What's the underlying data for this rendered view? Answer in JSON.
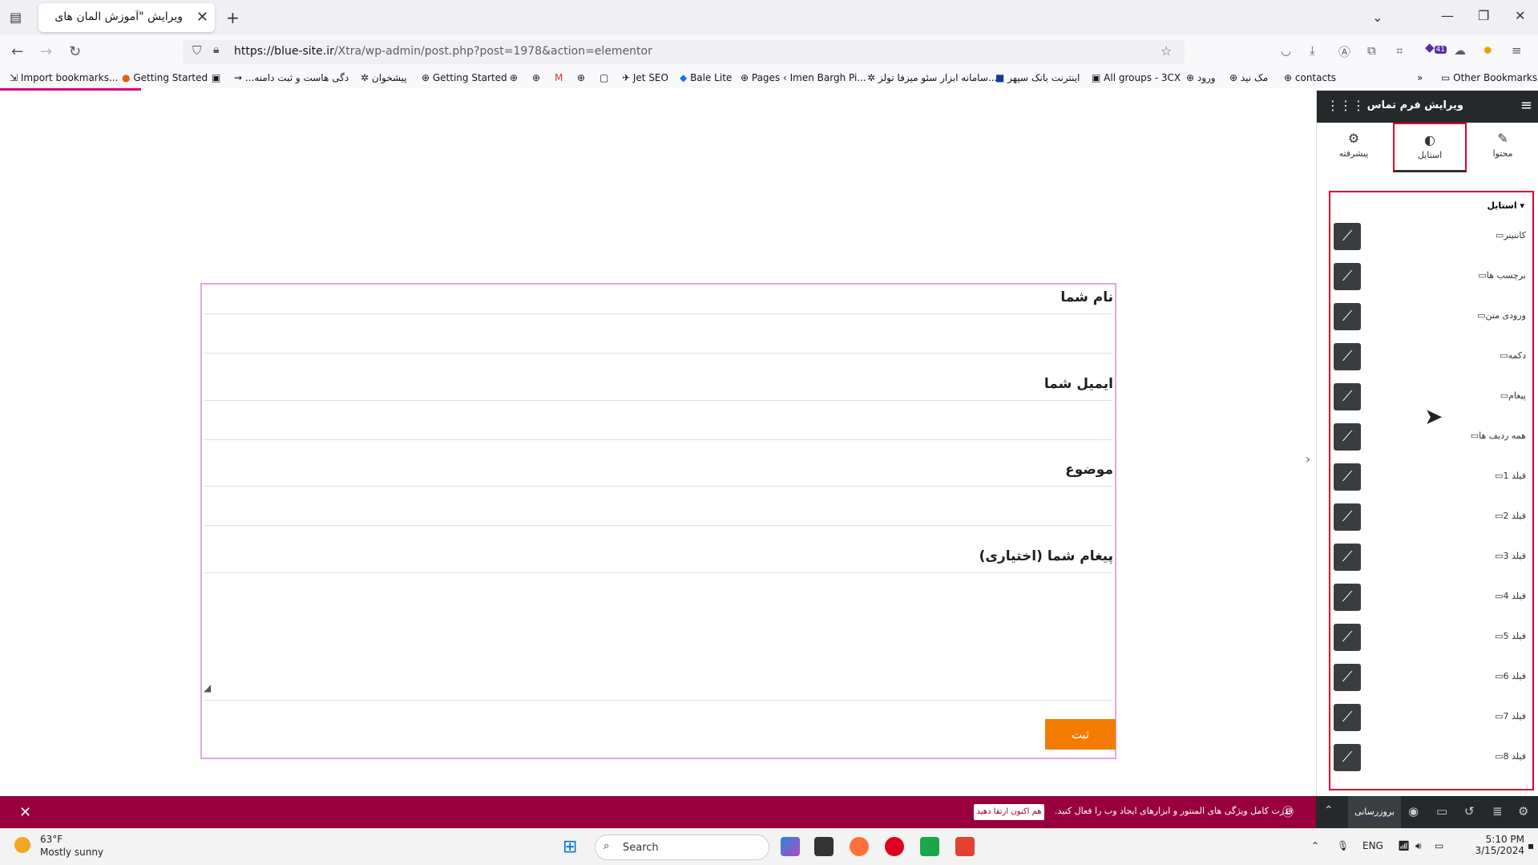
{
  "browser": {
    "tab_title": "ویرایش \"آموزش المان های اکسترا – ...",
    "url_host": "https://blue-site.ir",
    "url_path": "/Xtra/wp-admin/post.php?post=1978&action=elementor",
    "extension_badge": "41"
  },
  "bookmarks": {
    "items": [
      "Import bookmarks...",
      "Getting Started",
      "...دگی هاست و ثبت دامنه",
      "پیشخوان",
      "Getting Started",
      "Jet SEO",
      "Bale Lite",
      "Pages ‹ Imen Bargh Pi...",
      "سامانه ابزار سئو میزفا تولز...",
      "اینترنت بانک سپهر",
      "All groups - 3CX",
      "ورود",
      "مک نید",
      "contacts"
    ],
    "other": "Other Bookmarks"
  },
  "form": {
    "name_label": "نام شما",
    "email_label": "ایمیل شما",
    "subject_label": "موضوع",
    "message_label": "پیغام شما (اختیاری)",
    "submit_label": "ثبت"
  },
  "sidebar": {
    "title": "ویرایش فرم تماس",
    "tabs": {
      "content": "محتوا",
      "style": "استایل",
      "advanced": "پیشرفته"
    },
    "section_title": "استایل",
    "rows": [
      "کانتینر",
      "برچسب ها",
      "ورودی متن",
      "دکمه",
      "پیغام",
      "همه ردیف ها",
      "فیلد 1",
      "فیلد 2",
      "فیلد 3",
      "فیلد 4",
      "فیلد 5",
      "فیلد 6",
      "فیلد 7",
      "فیلد 8"
    ]
  },
  "promo": {
    "message": "قدرت کامل ویژگی های المنتور و ابزارهای ایجاد وب را فعال کنید.",
    "cta": "هم اکنون ارتقا دهید"
  },
  "editor_footer": {
    "update_label": "بروزرسانی"
  },
  "taskbar": {
    "temperature": "63°F",
    "condition": "Mostly sunny",
    "search_placeholder": "Search",
    "language": "ENG",
    "time": "5:10 PM",
    "date": "3/15/2024"
  },
  "colors": {
    "accent_orange": "#f27b00",
    "elementor_maroon": "#98003d",
    "highlight_red": "#e0002a",
    "sidebar_dark": "#26292c"
  }
}
